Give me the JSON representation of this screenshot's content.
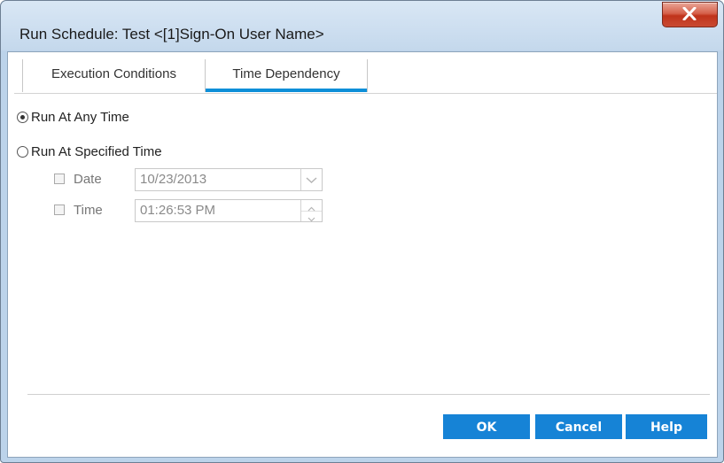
{
  "window": {
    "title": "Run Schedule: Test <[1]Sign-On User Name>"
  },
  "tabs": [
    {
      "label": "Execution Conditions",
      "selected": false
    },
    {
      "label": "Time Dependency",
      "selected": true
    }
  ],
  "run_options": {
    "any_time": {
      "label": "Run At Any Time",
      "selected": true
    },
    "specified_time": {
      "label": "Run At Specified Time",
      "selected": false
    }
  },
  "date": {
    "label": "Date",
    "checked": false,
    "value": "10/23/2013"
  },
  "time": {
    "label": "Time",
    "checked": false,
    "value": "01:26:53 PM"
  },
  "buttons": {
    "ok": "OK",
    "cancel": "Cancel",
    "help": "Help"
  },
  "colors": {
    "accent": "#0d8fd8",
    "button": "#1683d6",
    "close_button": "#c94a32",
    "window_frame": "#bcd3ea"
  },
  "icons": {
    "close": "close-icon",
    "dropdown": "chevron-down-icon",
    "spin_up": "chevron-up-icon",
    "spin_down": "chevron-down-icon"
  }
}
